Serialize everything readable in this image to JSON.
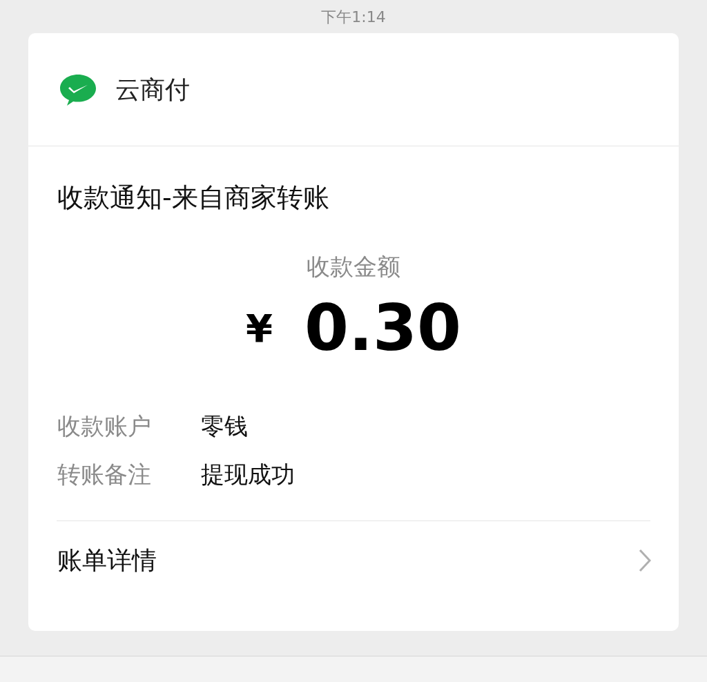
{
  "status_bar": {
    "time": "下午1:14"
  },
  "card": {
    "app_name": "云商付",
    "title": "收款通知-来自商家转账",
    "amount_label": "收款金额",
    "currency": "¥",
    "amount": "0.30",
    "details": [
      {
        "label": "收款账户",
        "value": "零钱"
      },
      {
        "label": "转账备注",
        "value": "提现成功"
      }
    ],
    "footer_link": "账单详情"
  }
}
